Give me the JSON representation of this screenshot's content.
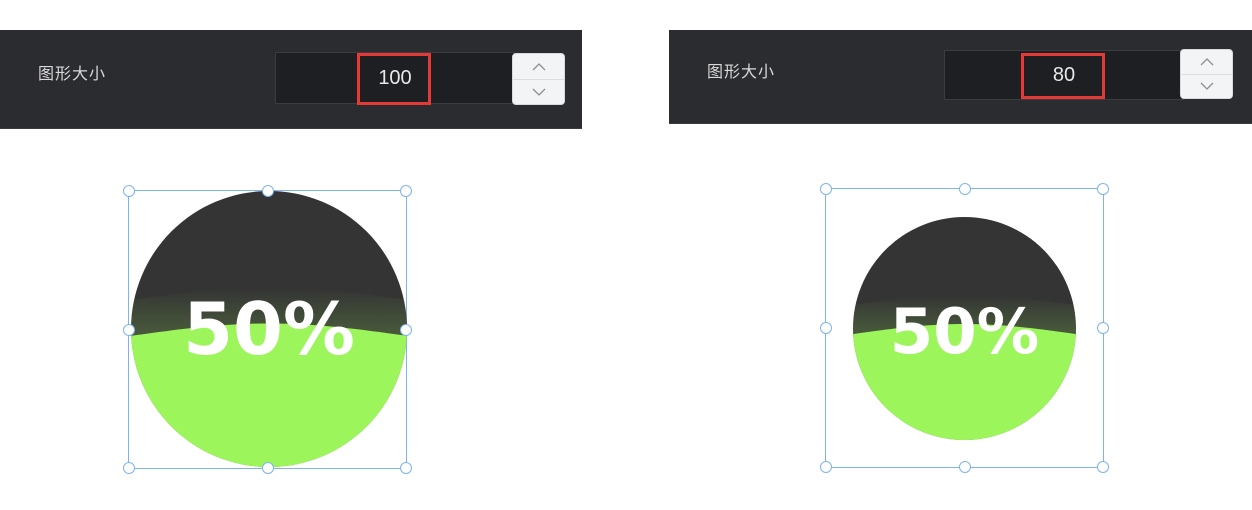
{
  "panels": [
    {
      "label": "图形大小",
      "value": "100",
      "stepper": {
        "up_icon": "chevron-up-icon",
        "down_icon": "chevron-down-icon"
      }
    },
    {
      "label": "图形大小",
      "value": "80",
      "stepper": {
        "up_icon": "chevron-up-icon",
        "down_icon": "chevron-down-icon"
      }
    }
  ],
  "gauges": [
    {
      "percent_text": "50%",
      "fill_level": 0.5
    },
    {
      "percent_text": "50%",
      "fill_level": 0.5
    }
  ],
  "colors": {
    "panel_bg": "#2b2c30",
    "input_bg": "#1e1f22",
    "highlight": "#e53935",
    "selection": "#7db4f0",
    "gauge_dark": "#343434",
    "gauge_liquid": "#9cf55a",
    "gauge_text": "#ffffff"
  }
}
